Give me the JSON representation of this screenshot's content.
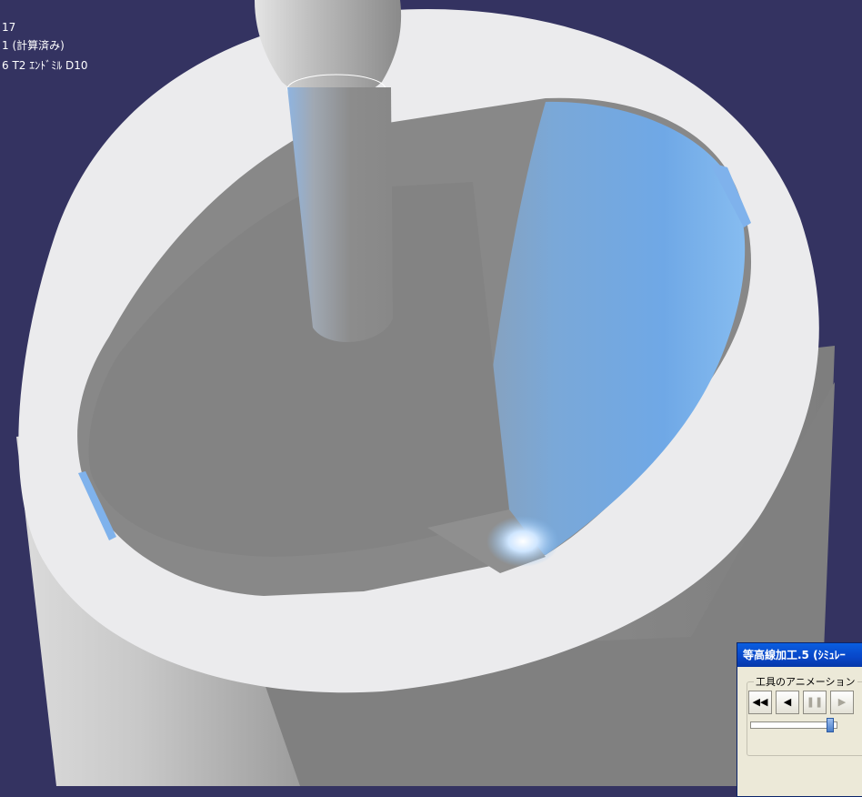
{
  "viewer": {
    "info_lines": [
      "17",
      "1 (計算済み)",
      "6  T2 ｴﾝﾄﾞﾐﾙ D10"
    ],
    "background_color": "#343361"
  },
  "dialog": {
    "title": "等高線加工.5 (ｼﾐｭﾚｰ",
    "group_label": "工具のアニメーション",
    "buttons": [
      {
        "icon": "rewind-icon",
        "glyph": "◀◀"
      },
      {
        "icon": "step-back-icon",
        "glyph": "◀"
      },
      {
        "icon": "pause-icon",
        "glyph": "❚❚"
      },
      {
        "icon": "play-icon",
        "glyph": "▶"
      }
    ],
    "slider_position": 0.95
  }
}
